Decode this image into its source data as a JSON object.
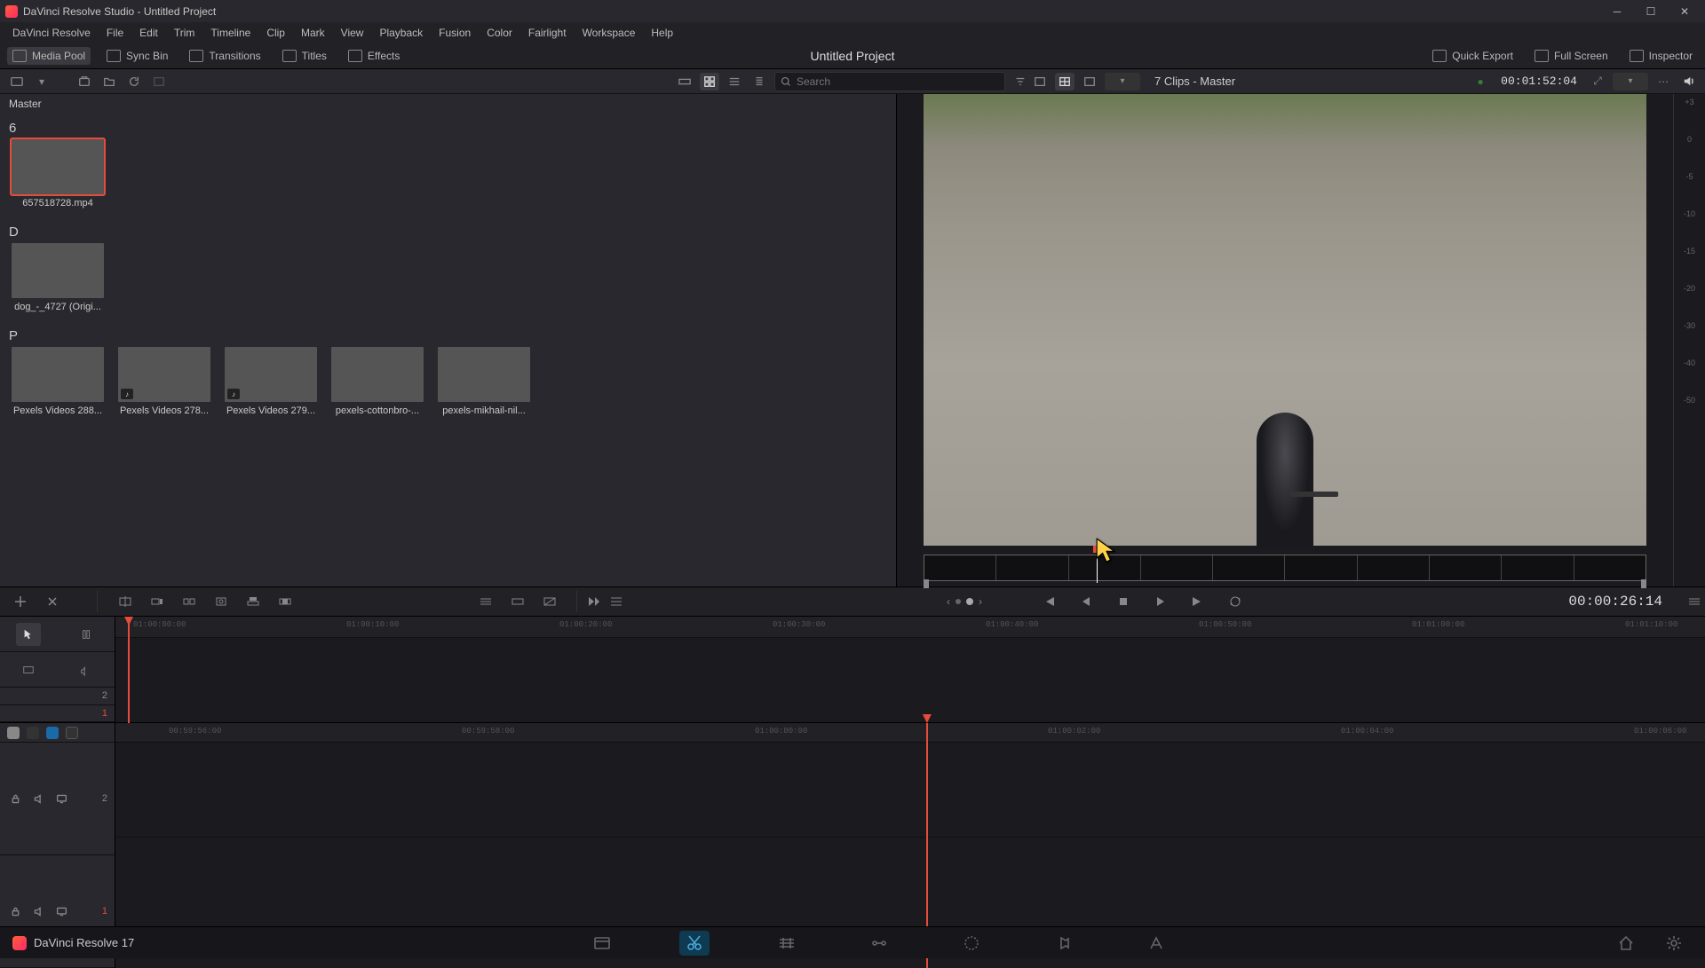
{
  "window": {
    "title": "DaVinci Resolve Studio - Untitled Project"
  },
  "menu": [
    "DaVinci Resolve",
    "File",
    "Edit",
    "Trim",
    "Timeline",
    "Clip",
    "Mark",
    "View",
    "Playback",
    "Fusion",
    "Color",
    "Fairlight",
    "Workspace",
    "Help"
  ],
  "topbar": {
    "media_pool": "Media Pool",
    "sync_bin": "Sync Bin",
    "transitions": "Transitions",
    "titles": "Titles",
    "effects": "Effects",
    "project": "Untitled Project",
    "quick_export": "Quick Export",
    "full_screen": "Full Screen",
    "inspector": "Inspector"
  },
  "panelbar": {
    "search_placeholder": "Search",
    "clip_info": "7 Clips - Master",
    "master_timecode": "00:01:52:04"
  },
  "mediapool": {
    "crumb": "Master",
    "groups": [
      {
        "letter": "6",
        "clips": [
          {
            "name": "657518728.mp4",
            "thumb": "th1",
            "selected": true
          }
        ]
      },
      {
        "letter": "D",
        "clips": [
          {
            "name": "dog_-_4727 (Origi...",
            "thumb": "th2"
          }
        ]
      },
      {
        "letter": "P",
        "clips": [
          {
            "name": "Pexels Videos 288...",
            "thumb": "th3"
          },
          {
            "name": "Pexels Videos 278...",
            "thumb": "th4",
            "audio": true
          },
          {
            "name": "Pexels Videos 279...",
            "thumb": "th5",
            "audio": true
          },
          {
            "name": "pexels-cottonbro-...",
            "thumb": "th6"
          },
          {
            "name": "pexels-mikhail-nil...",
            "thumb": "th7"
          }
        ]
      }
    ]
  },
  "meters": {
    "labels": [
      "+3",
      "0",
      "-5",
      "-10",
      "-15",
      "-20",
      "-30",
      "-40",
      "-50"
    ]
  },
  "transport": {
    "current_tc": "00:00:26:14"
  },
  "overview": {
    "tracks": [
      "2",
      "1"
    ],
    "ruler": [
      "01:00:00:00",
      "01:00:10:00",
      "01:00:20:00",
      "01:00:30:00",
      "01:00:40:00",
      "01:00:50:00",
      "01:01:00:00",
      "01:01:10:00"
    ]
  },
  "detail": {
    "ruler": [
      "00:59:56:00",
      "00:59:58:00",
      "01:00:00:00",
      "01:00:02:00",
      "01:00:04:00",
      "01:00:06:00"
    ],
    "video_track": "2",
    "audio_track": "1"
  },
  "footer": {
    "app": "DaVinci Resolve 17"
  }
}
